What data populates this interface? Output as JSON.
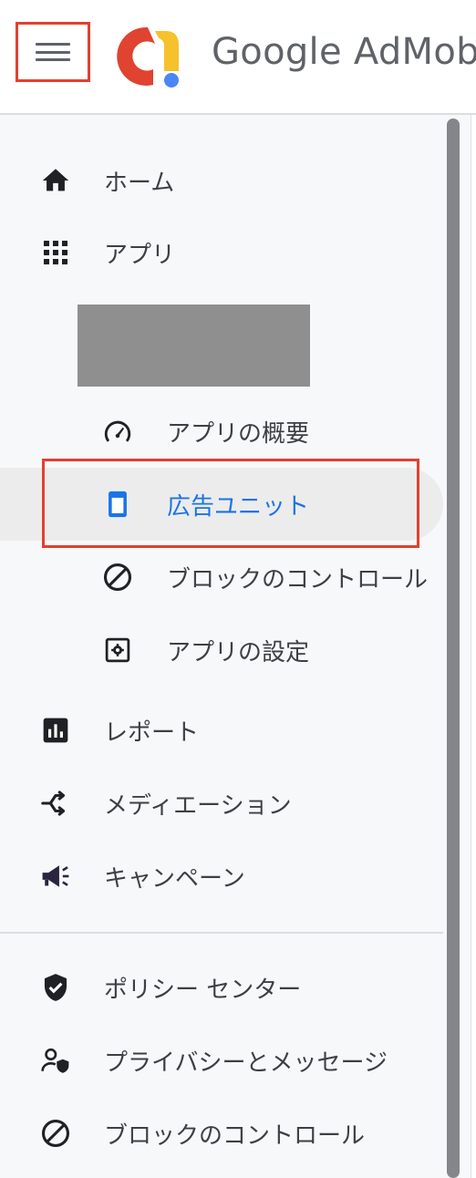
{
  "header": {
    "brand_text": "Google AdMob"
  },
  "sidebar": {
    "top_items": [
      {
        "label": "ホーム",
        "icon": "home-icon"
      },
      {
        "label": "アプリ",
        "icon": "apps-grid-icon"
      }
    ],
    "app_sub_items": [
      {
        "label": "アプリの概要",
        "icon": "speedometer-icon"
      },
      {
        "label": "広告ユニット",
        "icon": "ad-unit-icon",
        "active": true
      },
      {
        "label": "ブロックのコントロール",
        "icon": "block-icon"
      },
      {
        "label": "アプリの設定",
        "icon": "settings-square-icon"
      }
    ],
    "main_items": [
      {
        "label": "レポート",
        "icon": "bar-chart-icon"
      },
      {
        "label": "メディエーション",
        "icon": "mediation-icon"
      },
      {
        "label": "キャンペーン",
        "icon": "megaphone-icon"
      }
    ],
    "bottom_items": [
      {
        "label": "ポリシー センター",
        "icon": "shield-check-icon"
      },
      {
        "label": "プライバシーとメッセージ",
        "icon": "privacy-person-icon"
      },
      {
        "label": "ブロックのコントロール",
        "icon": "block-icon"
      }
    ]
  },
  "colors": {
    "accent": "#1a73e8",
    "highlight_border": "#e3402f",
    "text": "#3c4043",
    "icon": "#202124"
  }
}
